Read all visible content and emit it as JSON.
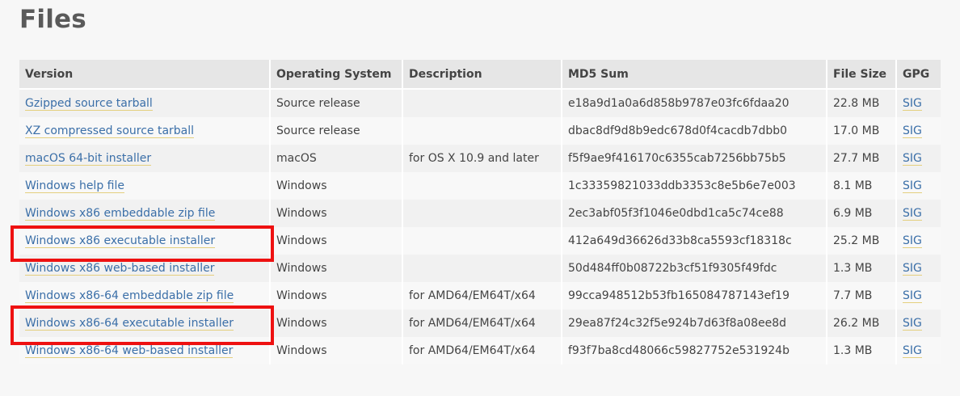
{
  "page": {
    "title": "Files"
  },
  "table": {
    "headers": {
      "version": "Version",
      "os": "Operating System",
      "description": "Description",
      "md5": "MD5 Sum",
      "size": "File Size",
      "gpg": "GPG"
    },
    "rows": [
      {
        "version": "Gzipped source tarball",
        "os": "Source release",
        "description": "",
        "md5": "e18a9d1a0a6d858b9787e03fc6fdaa20",
        "size": "22.8 MB",
        "gpg": "SIG"
      },
      {
        "version": "XZ compressed source tarball",
        "os": "Source release",
        "description": "",
        "md5": "dbac8df9d8b9edc678d0f4cacdb7dbb0",
        "size": "17.0 MB",
        "gpg": "SIG"
      },
      {
        "version": "macOS 64-bit installer",
        "os": "macOS",
        "description": "for OS X 10.9 and later",
        "md5": "f5f9ae9f416170c6355cab7256bb75b5",
        "size": "27.7 MB",
        "gpg": "SIG"
      },
      {
        "version": "Windows help file",
        "os": "Windows",
        "description": "",
        "md5": "1c33359821033ddb3353c8e5b6e7e003",
        "size": "8.1 MB",
        "gpg": "SIG"
      },
      {
        "version": "Windows x86 embeddable zip file",
        "os": "Windows",
        "description": "",
        "md5": "2ec3abf05f3f1046e0dbd1ca5c74ce88",
        "size": "6.9 MB",
        "gpg": "SIG"
      },
      {
        "version": "Windows x86 executable installer",
        "os": "Windows",
        "description": "",
        "md5": "412a649d36626d33b8ca5593cf18318c",
        "size": "25.2 MB",
        "gpg": "SIG"
      },
      {
        "version": "Windows x86 web-based installer",
        "os": "Windows",
        "description": "",
        "md5": "50d484ff0b08722b3cf51f9305f49fdc",
        "size": "1.3 MB",
        "gpg": "SIG"
      },
      {
        "version": "Windows x86-64 embeddable zip file",
        "os": "Windows",
        "description": "for AMD64/EM64T/x64",
        "md5": "99cca948512b53fb165084787143ef19",
        "size": "7.7 MB",
        "gpg": "SIG"
      },
      {
        "version": "Windows x86-64 executable installer",
        "os": "Windows",
        "description": "for AMD64/EM64T/x64",
        "md5": "29ea87f24c32f5e924b7d63f8a08ee8d",
        "size": "26.2 MB",
        "gpg": "SIG"
      },
      {
        "version": "Windows x86-64 web-based installer",
        "os": "Windows",
        "description": "for AMD64/EM64T/x64",
        "md5": "f93f7ba8cd48066c59827752e531924b",
        "size": "1.3 MB",
        "gpg": "SIG"
      }
    ]
  },
  "annotations": {
    "highlight_color": "#ee1111",
    "highlighted_rows": [
      5,
      8
    ]
  }
}
